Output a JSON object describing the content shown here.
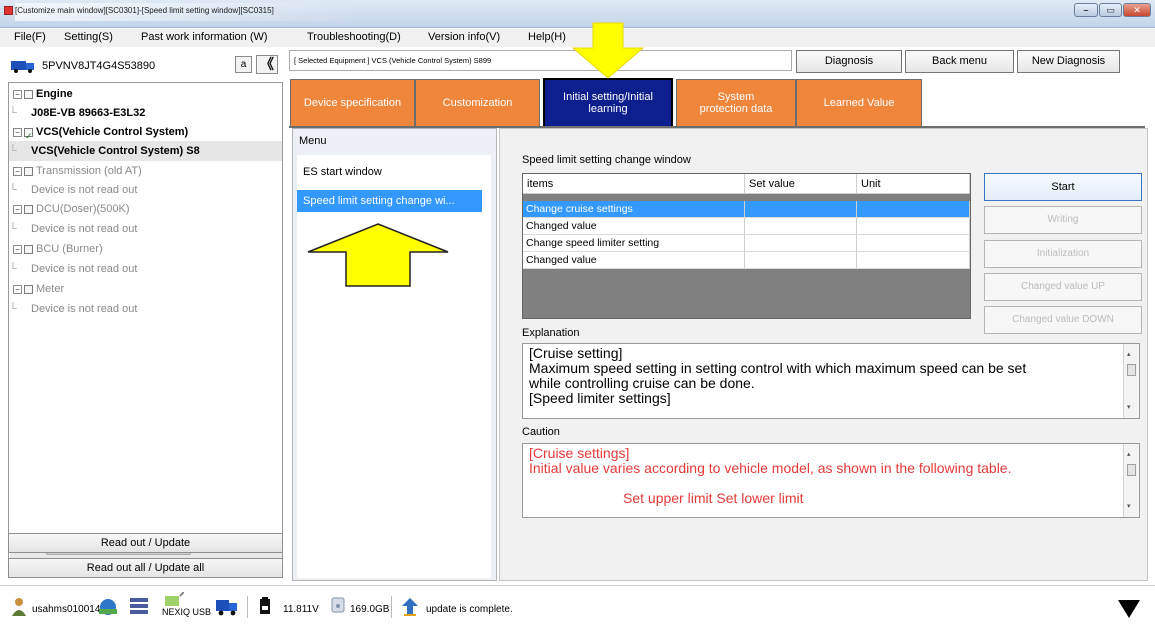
{
  "window": {
    "title": "[Customize main window][SC0301]-[Speed limit setting window][SC0315]"
  },
  "menubar": {
    "items": [
      "File(F)",
      "Setting(S)",
      "Past work information (W)",
      "Troubleshooting(D)",
      "Version info(V)",
      "Help(H)"
    ]
  },
  "left": {
    "device_id": "5PVNV8JT4G4S53890",
    "a_button": "a",
    "collapse_button": "《",
    "tree": [
      {
        "label": "Engine",
        "level": 0,
        "style": "bold"
      },
      {
        "label": "J08E-VB 89663-E3L32",
        "level": 1,
        "style": "bold"
      },
      {
        "label": "VCS(Vehicle Control System)",
        "level": 0,
        "style": "bold",
        "checked": true
      },
      {
        "label": "VCS(Vehicle Control System) S8",
        "level": 1,
        "style": "bold",
        "selected": true
      },
      {
        "label": "Transmission (old AT)",
        "level": 0,
        "style": "grey"
      },
      {
        "label": "Device is not read out",
        "level": 1,
        "style": "grey"
      },
      {
        "label": "DCU(Doser)(500K)",
        "level": 0,
        "style": "grey"
      },
      {
        "label": "Device is not read out",
        "level": 1,
        "style": "grey"
      },
      {
        "label": "BCU (Burner)",
        "level": 0,
        "style": "grey"
      },
      {
        "label": "Device is not read out",
        "level": 1,
        "style": "grey"
      },
      {
        "label": "Meter",
        "level": 0,
        "style": "grey"
      },
      {
        "label": "Device is not read out",
        "level": 1,
        "style": "grey"
      }
    ],
    "read_update_label": "Read out / Update",
    "read_all_label": "Read out all / Update all"
  },
  "topbar": {
    "selected_equipment": "[ Selected Equipment ] VCS (Vehicle Control System) S899",
    "diagnosis": "Diagnosis",
    "back_menu": "Back menu",
    "new_diagnosis": "New Diagnosis"
  },
  "tabs": [
    {
      "label": "Device specification",
      "active": false
    },
    {
      "label": "Customization",
      "active": false
    },
    {
      "label": "Initial setting/Initial learning",
      "active": true
    },
    {
      "label": "System protection data",
      "active": false
    },
    {
      "label": "Learned Value",
      "active": false
    }
  ],
  "menu_panel": {
    "heading": "Menu",
    "items": [
      "ES start window",
      "Speed limit setting change wi..."
    ],
    "selected_index": 1
  },
  "content": {
    "title": "Speed limit setting change window",
    "grid": {
      "headers": [
        "items",
        "Set value",
        "Unit"
      ],
      "rows": [
        {
          "item": "Change cruise settings",
          "set_value": "",
          "unit": ""
        },
        {
          "item": "Changed value",
          "set_value": "",
          "unit": ""
        },
        {
          "item": "Change speed limiter setting",
          "set_value": "",
          "unit": ""
        },
        {
          "item": "Changed value",
          "set_value": "",
          "unit": ""
        }
      ],
      "selected_row": 0
    },
    "buttons": {
      "start": "Start",
      "writing": "Writing",
      "initialization": "Initialization",
      "changed_up": "Changed value UP",
      "changed_down": "Changed value DOWN"
    },
    "explanation_label": "Explanation",
    "explanation_lines": [
      "[Cruise setting]",
      "Maximum speed setting in setting control with which maximum speed can be set",
      "while controlling cruise can be done.",
      "[Speed limiter settings]"
    ],
    "caution_label": "Caution",
    "caution_lines": [
      "[Cruise settings]",
      "Initial value varies according to vehicle model, as shown in the following table.",
      "",
      "Set upper limit  Set lower limit"
    ]
  },
  "statusbar": {
    "user": "usahms010014",
    "device_name": "NEXIQ USB",
    "voltage": "11.811V",
    "disk": "169.0GB",
    "status": "update is complete."
  },
  "colors": {
    "tab_orange": "#f0863c",
    "tab_active": "#0c1f8d",
    "selection_blue": "#3399ff",
    "caution_red": "#e53a3a",
    "annotation_yellow": "#ffff00"
  }
}
